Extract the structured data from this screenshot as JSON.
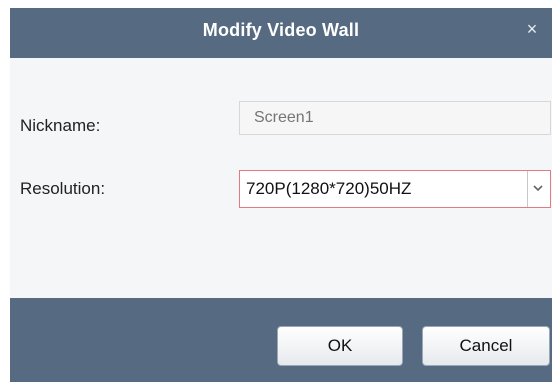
{
  "dialog": {
    "title": "Modify Video Wall",
    "close_glyph": "×"
  },
  "form": {
    "nickname_label": "Nickname:",
    "nickname_placeholder": "Screen1",
    "nickname_value": "",
    "resolution_label": "Resolution:",
    "resolution_value": "720P(1280*720)50HZ"
  },
  "buttons": {
    "ok_label": "OK",
    "cancel_label": "Cancel"
  },
  "colors": {
    "header_background": "#566a82",
    "footer_background": "#566a82",
    "active_field_border": "#e07b82"
  },
  "icons": {
    "close": "close-icon",
    "dropdown": "chevron-down-icon"
  }
}
